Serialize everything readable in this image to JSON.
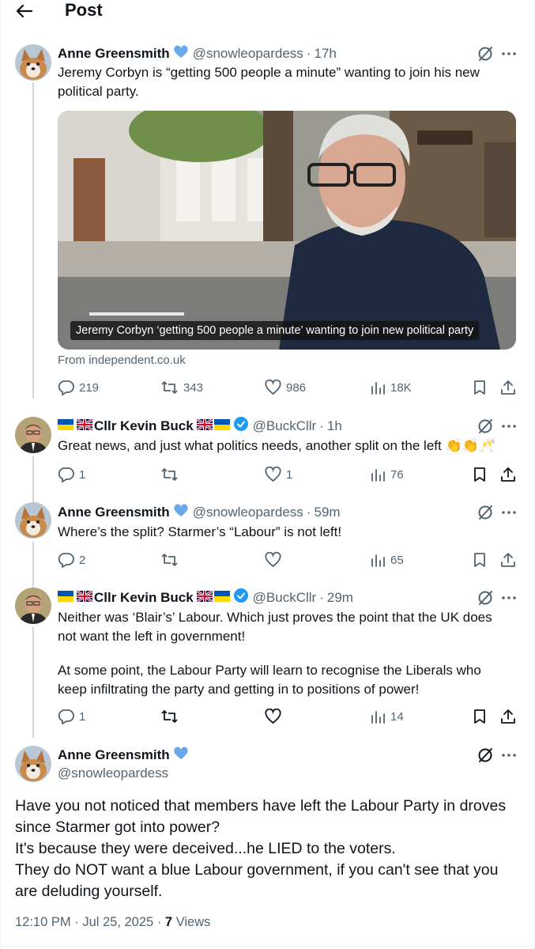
{
  "header": {
    "title": "Post"
  },
  "colors": {
    "verified_blue": "#1d9bf0",
    "heart_badge": "#6aa9e9",
    "secondary_text": "#536471"
  },
  "posts": [
    {
      "name": "Anne Greensmith",
      "handle": "@snowleopardess",
      "time": "17h",
      "text": "Jeremy Corbyn is “getting 500 people a minute” wanting to join his new political party.",
      "media": {
        "caption": "Jeremy Corbyn ‘getting 500 people a minute’ wanting to join new political party",
        "source": "From independent.co.uk"
      },
      "stats": {
        "replies": "219",
        "reposts": "343",
        "likes": "986",
        "views": "18K"
      }
    },
    {
      "name": "Cllr Kevin Buck",
      "handle": "@BuckCllr",
      "time": "1h",
      "text": "Great news, and just what politics needs, another split on the left 👏👏🥂",
      "stats": {
        "replies": "1",
        "reposts": "",
        "likes": "1",
        "views": "76"
      }
    },
    {
      "name": "Anne Greensmith",
      "handle": "@snowleopardess",
      "time": "59m",
      "text": "Where’s the split? Starmer’s “Labour” is not left!",
      "stats": {
        "replies": "2",
        "reposts": "",
        "likes": "",
        "views": "65"
      }
    },
    {
      "name": "Cllr Kevin Buck",
      "handle": "@BuckCllr",
      "time": "29m",
      "text_p1": "Neither was ‘Blair’s’ Labour. Which just proves the point that the UK does not want the left in government!",
      "text_p2": "At some point, the Labour Party will learn to recognise the Liberals who keep infiltrating the party and getting in to positions of power!",
      "stats": {
        "replies": "1",
        "reposts": "",
        "likes": "",
        "views": "14"
      }
    }
  ],
  "main_post": {
    "name": "Anne Greensmith",
    "handle": "@snowleopardess",
    "lines": [
      "Have you not noticed that members have left the Labour Party in droves since Starmer got into power?",
      "It's because they were deceived...he LIED to the voters.",
      "They do NOT want a blue Labour government, if you can't see that you are deluding yourself."
    ],
    "time": "12:10 PM",
    "date": "Jul 25, 2025",
    "views_count": "7",
    "views_label": "Views"
  }
}
